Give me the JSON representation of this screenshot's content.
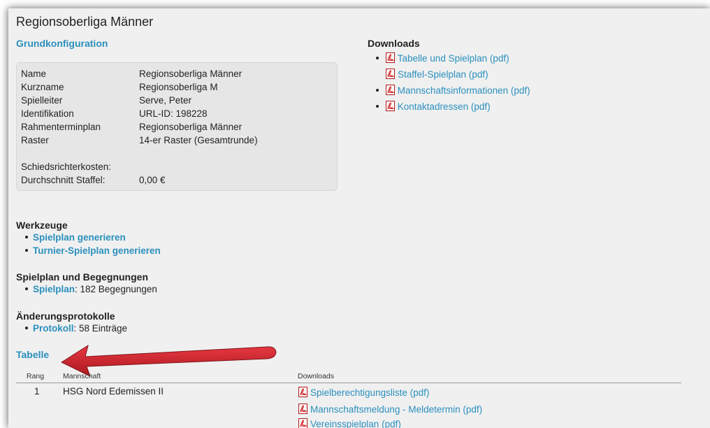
{
  "title": "Regionsoberliga Männer",
  "grundkonfiguration": {
    "heading": "Grundkonfiguration",
    "rows": [
      {
        "label": "Name",
        "value": "Regionsoberliga Männer"
      },
      {
        "label": "Kurzname",
        "value": "Regionsoberliga M"
      },
      {
        "label": "Spielleiter",
        "value": "Serve, Peter"
      },
      {
        "label": "Identifikation",
        "value": "URL-ID: 198228"
      },
      {
        "label": "Rahmenterminplan",
        "value": "Regionsoberliga Männer"
      },
      {
        "label": "Raster",
        "value": "14-er Raster (Gesamtrunde)"
      }
    ],
    "schiri_label": "Schiedsrichterkosten:",
    "schnitt_label": "Durchschnitt Staffel:",
    "schnitt_value": "0,00 €"
  },
  "downloads": {
    "heading": "Downloads",
    "items": [
      "Tabelle und Spielplan (pdf)",
      "Staffel-Spielplan (pdf)",
      "Mannschaftsinformationen (pdf)",
      "Kontaktadressen (pdf)"
    ]
  },
  "werkzeuge": {
    "heading": "Werkzeuge",
    "items": [
      "Spielplan generieren",
      "Turnier-Spielplan generieren"
    ]
  },
  "spielplan": {
    "heading": "Spielplan und Begegnungen",
    "link": "Spielplan",
    "text": ": 182 Begegnungen"
  },
  "protokolle": {
    "heading": "Änderungsprotokolle",
    "link": "Protokoll",
    "text": ": 58 Einträge"
  },
  "tabelle": {
    "heading": "Tabelle",
    "columns": [
      "Rang",
      "Mannschaft",
      "Downloads"
    ],
    "rows": [
      {
        "rang": "1",
        "mannschaft": "HSG Nord Edemissen II",
        "downloads": [
          "Spielberechtigungsliste (pdf)",
          "Mannschaftsmeldung - Meldetermin (pdf)",
          "Vereinsspielplan (pdf)"
        ]
      }
    ]
  },
  "colors": {
    "link": "#2a8fbd",
    "arrow": "#c8101a",
    "panel": "#f0f0f0",
    "pdf": "#d42a2a"
  },
  "icons": [
    "pdf-icon",
    "arrow-annotation"
  ]
}
